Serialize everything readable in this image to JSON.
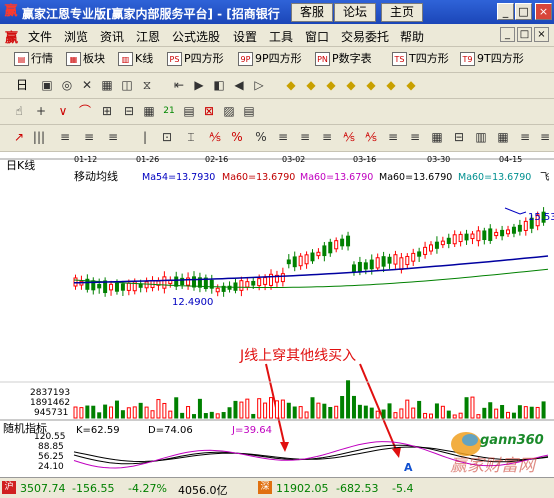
{
  "window": {
    "title": "赢家江恩专业版[赢家内部服务平台] - [招商银行",
    "tab_buttons": [
      "客服",
      "论坛",
      "主页"
    ],
    "controls": [
      "_",
      "□",
      "×"
    ]
  },
  "menubar": {
    "logo": "赢",
    "items": [
      "文件",
      "浏览",
      "资讯",
      "江恩",
      "公式选股",
      "设置",
      "工具",
      "窗口",
      "交易委托",
      "帮助"
    ],
    "mdi_controls": [
      "_",
      "□",
      "×"
    ]
  },
  "toolbar1": {
    "items": [
      {
        "label": "行情",
        "icon": "▤"
      },
      {
        "label": "板块",
        "icon": "▦"
      },
      {
        "label": "K线",
        "icon": "▥"
      },
      {
        "label": "P四方形",
        "icon": "PS"
      },
      {
        "label": "9P四方形",
        "icon": "9P"
      },
      {
        "label": "P数字表",
        "icon": "PN"
      },
      {
        "label": "T四方形",
        "icon": "TS"
      },
      {
        "label": "9T四方形",
        "icon": "T9"
      }
    ]
  },
  "toolbar2": {
    "period": "日",
    "icons": [
      "▣",
      "◎",
      "✕",
      "▦",
      "◫",
      "⧖",
      "⇤",
      "▶",
      "◧",
      "◀",
      "▷",
      "◆",
      "◆",
      "◆",
      "◆",
      "◆",
      "◆",
      "◆"
    ]
  },
  "toolbar3": {
    "icons": [
      "☝",
      "+",
      "∨",
      "⌒",
      "⊞",
      "⊟",
      "▦",
      "21",
      "▤",
      "⊠",
      "▨",
      "▤"
    ]
  },
  "toolbar4": {
    "icons": [
      "↗",
      "|||",
      "≡",
      "≡",
      "≡",
      "|",
      "⊡",
      "⌶",
      "⅍",
      "%",
      "%",
      "≡",
      "≡",
      "≡",
      "⅍",
      "⅍",
      "≡",
      "≡",
      "▦",
      "⊟",
      "▥",
      "▦",
      "≡",
      "≡"
    ]
  },
  "chart": {
    "period_label": "日K线",
    "dates": [
      "01-12",
      "01-26",
      "02-16",
      "03-02",
      "03-16",
      "03-30",
      "04-15"
    ],
    "ma_title": "移动均线",
    "ma_legend": [
      {
        "text": "Ma54=13.7930",
        "color": "#0000c0"
      },
      {
        "text": "Ma60=13.6790",
        "color": "#c00000"
      },
      {
        "text": "Ma60=13.6790",
        "color": "#c000c0"
      },
      {
        "text": "Ma60=13.6790",
        "color": "#000000"
      },
      {
        "text": "Ma60=13.6790",
        "color": "#009090"
      }
    ],
    "legend_cut": "飞",
    "high_label": "15.53",
    "low_label": "12.4900",
    "annotation": "J线上穿其他线买入",
    "volume_axis": [
      "2837193",
      "1891462",
      "945731"
    ],
    "kdj_title": "随机指标",
    "kdj_axis": [
      "120.55",
      "88.85",
      "56.25",
      "24.10"
    ],
    "kdj_values": [
      {
        "text": "K=62.59",
        "color": "#000000"
      },
      {
        "text": "D=74.06",
        "color": "#000000"
      },
      {
        "text": "J=39.64",
        "color": "#c000c0"
      }
    ],
    "buy_marker": "A",
    "watermark_brand": "gann360",
    "watermark_slogan": "赢家财富网",
    "colors": {
      "up": "#ff0000",
      "down": "#008000",
      "ma_long": "#0000a0",
      "ma_mid": "#008000"
    }
  },
  "statusbar": {
    "sh_badge": "沪",
    "sh_index": "3507.74",
    "sh_change": "-156.55",
    "sh_pct": "-4.27%",
    "sh_amount": "4056.0亿",
    "sz_badge": "深",
    "sz_index": "11902.05",
    "sz_change": "-682.53",
    "sz_pct": "-5.4"
  }
}
